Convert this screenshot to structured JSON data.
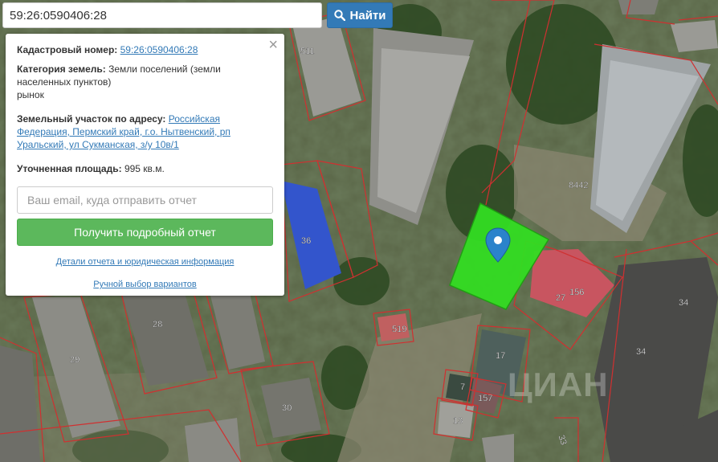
{
  "search": {
    "value": "59:26:0590406:28",
    "button_label": "Найти",
    "button_icon": "search-icon"
  },
  "popup": {
    "cadastral_label": "Кадастровый номер:",
    "cadastral_value": "59:26:0590406:28",
    "category_label": "Категория земель:",
    "category_value": "Земли поселений (земли населенных пунктов)",
    "use": "рынок",
    "address_label": "Земельный участок по адресу:",
    "address_value": "Российская Федерация, Пермский край, г.о. Нытвенский, рп Уральский, ул Сукманская, з/у 10в/1",
    "area_label": "Уточненная площадь:",
    "area_value": "995 кв.м.",
    "email_placeholder": "Ваш email, куда отправить отчет",
    "report_button": "Получить подробный отчет",
    "details_link": "Детали отчета и юридическая информация",
    "manual_link": "Ручной выбор вариантов",
    "close_icon": "close-icon"
  },
  "map": {
    "colors": {
      "parcel_border": "#d03030",
      "selected_fill": "#33dd22",
      "roof_blue": "#3355cc",
      "roof_red": "#c85560",
      "marker": "#2b83cb"
    },
    "labels": [
      "511",
      "8442",
      "36",
      "156",
      "27",
      "34",
      "34",
      "28",
      "29",
      "519",
      "17",
      "7",
      "157",
      "13",
      "30",
      "33"
    ],
    "watermark": "ЦИАН"
  }
}
